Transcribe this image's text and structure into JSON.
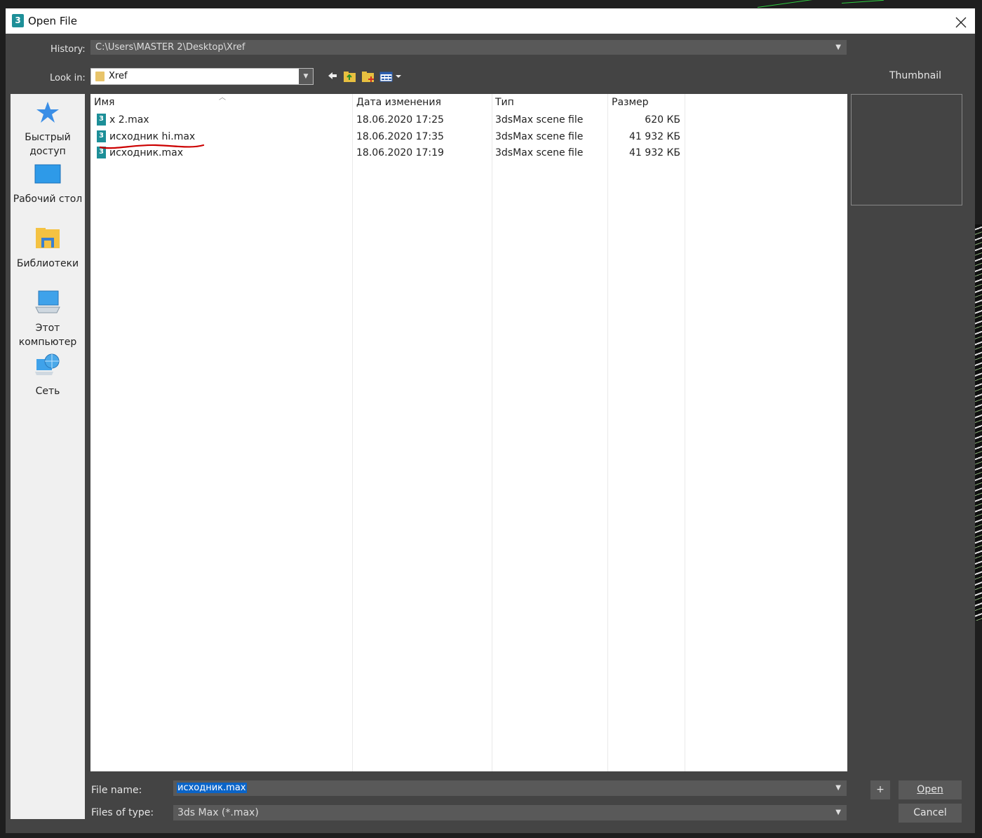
{
  "dialog": {
    "title": "Open File",
    "app_icon_glyph": "3"
  },
  "history": {
    "label": "History:",
    "value": "C:\\Users\\MASTER 2\\Desktop\\Xref"
  },
  "look_in": {
    "label": "Look in:",
    "value": "Xref"
  },
  "thumbnail": {
    "label": "Thumbnail"
  },
  "places": [
    {
      "label_line1": "Быстрый",
      "label_line2": "доступ",
      "icon": "star-icon"
    },
    {
      "label_line1": "Рабочий стол",
      "label_line2": "",
      "icon": "desktop-icon"
    },
    {
      "label_line1": "Библиотеки",
      "label_line2": "",
      "icon": "libraries-icon"
    },
    {
      "label_line1": "Этот",
      "label_line2": "компьютер",
      "icon": "computer-icon"
    },
    {
      "label_line1": "Сеть",
      "label_line2": "",
      "icon": "network-icon"
    }
  ],
  "columns": {
    "name": "Имя",
    "date": "Дата изменения",
    "type": "Тип",
    "size": "Размер"
  },
  "files": [
    {
      "name": "x 2.max",
      "date": "18.06.2020 17:25",
      "type": "3dsMax scene file",
      "size": "620 КБ"
    },
    {
      "name": "исходник hi.max",
      "date": "18.06.2020 17:35",
      "type": "3dsMax scene file",
      "size": "41 932 КБ"
    },
    {
      "name": "исходник.max",
      "date": "18.06.2020 17:19",
      "type": "3dsMax scene file",
      "size": "41 932 КБ"
    }
  ],
  "file_name": {
    "label": "File name:",
    "value": "исходник.max"
  },
  "files_of_type": {
    "label": "Files of type:",
    "value": "3ds Max (*.max)"
  },
  "buttons": {
    "plus": "+",
    "open": "Open",
    "cancel": "Cancel"
  },
  "colors": {
    "dialog_bg": "#444444",
    "input_bg": "#595959",
    "selection": "#0a64c8",
    "annotation": "#cc0000",
    "max_icon": "#1d8f98"
  }
}
